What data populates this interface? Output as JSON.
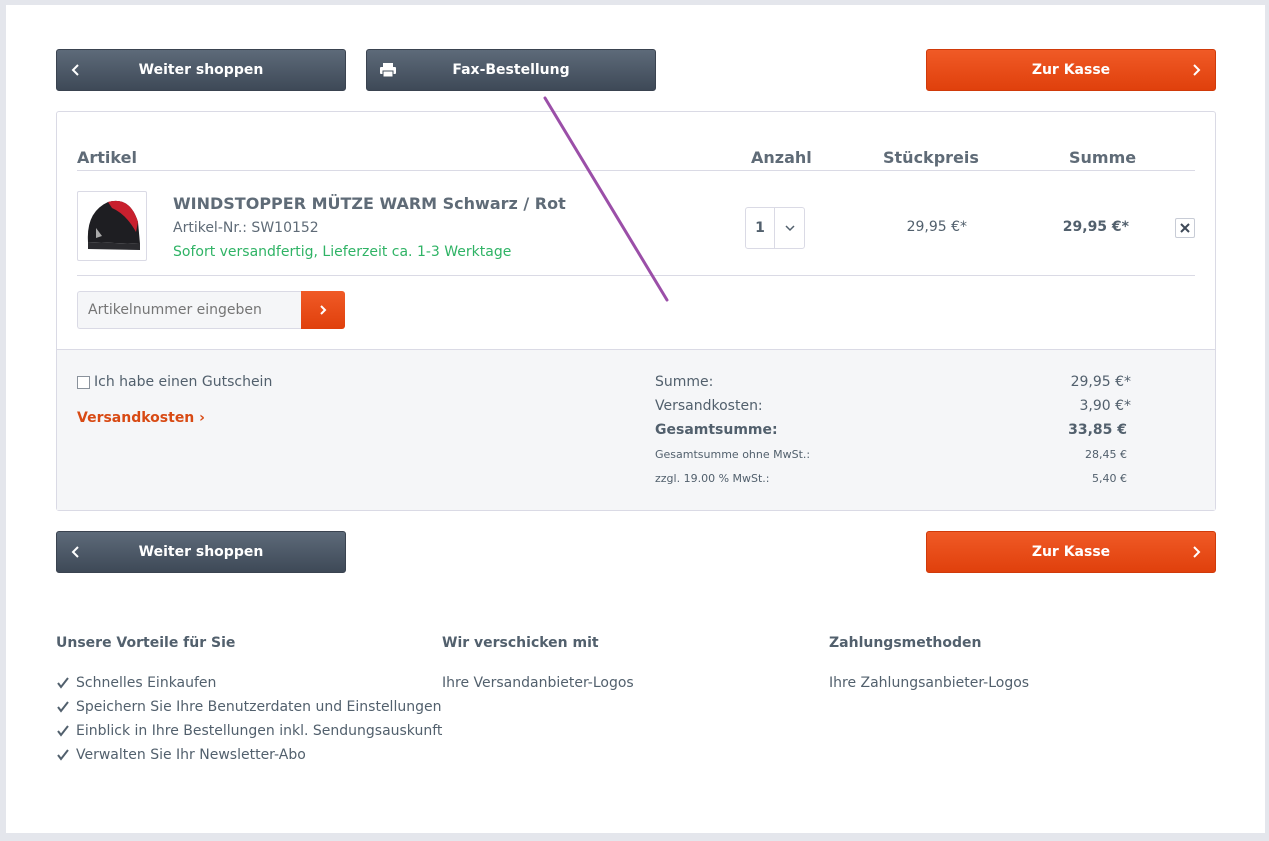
{
  "buttons": {
    "continue_shopping": "Weiter shoppen",
    "fax_order": "Fax-Bestellung",
    "checkout": "Zur Kasse"
  },
  "table": {
    "headers": {
      "article": "Artikel",
      "quantity": "Anzahl",
      "unit_price": "Stückpreis",
      "total": "Summe"
    }
  },
  "item": {
    "name": "WINDSTOPPER MÜTZE WARM Schwarz / Rot",
    "article_number": "Artikel-Nr.: SW10152",
    "delivery": "Sofort versandfertig, Lieferzeit ca. 1-3 Werktage",
    "quantity": "1",
    "unit_price": "29,95 €*",
    "total": "29,95 €*"
  },
  "add_article": {
    "placeholder": "Artikelnummer eingeben"
  },
  "summary": {
    "voucher_label": "Ich habe einen Gutschein",
    "shipping_link": "Versandkosten",
    "rows": [
      {
        "label": "Summe:",
        "value": "29,95 €*"
      },
      {
        "label": "Versandkosten:",
        "value": "3,90 €*"
      },
      {
        "label": "Gesamtsumme:",
        "value": "33,85 €"
      },
      {
        "label": "Gesamtsumme ohne MwSt.:",
        "value": "28,45 €"
      },
      {
        "label": "zzgl. 19.00 % MwSt.:",
        "value": "5,40 €"
      }
    ]
  },
  "footer": {
    "benefits": {
      "title": "Unsere Vorteile für Sie",
      "items": [
        "Schnelles Einkaufen",
        "Speichern Sie Ihre Benutzerdaten und Einstellungen",
        "Einblick in Ihre Bestellungen inkl. Sendungsauskunft",
        "Verwalten Sie Ihr Newsletter-Abo"
      ]
    },
    "shipping": {
      "title": "Wir verschicken mit",
      "text": "Ihre Versandanbieter-Logos"
    },
    "payment": {
      "title": "Zahlungsmethoden",
      "text": "Ihre Zahlungsanbieter-Logos"
    }
  },
  "colors": {
    "accent": "#e8491a",
    "dark_button": "#4a5563",
    "success": "#2fb365",
    "annotation": "#9b4fa8"
  }
}
